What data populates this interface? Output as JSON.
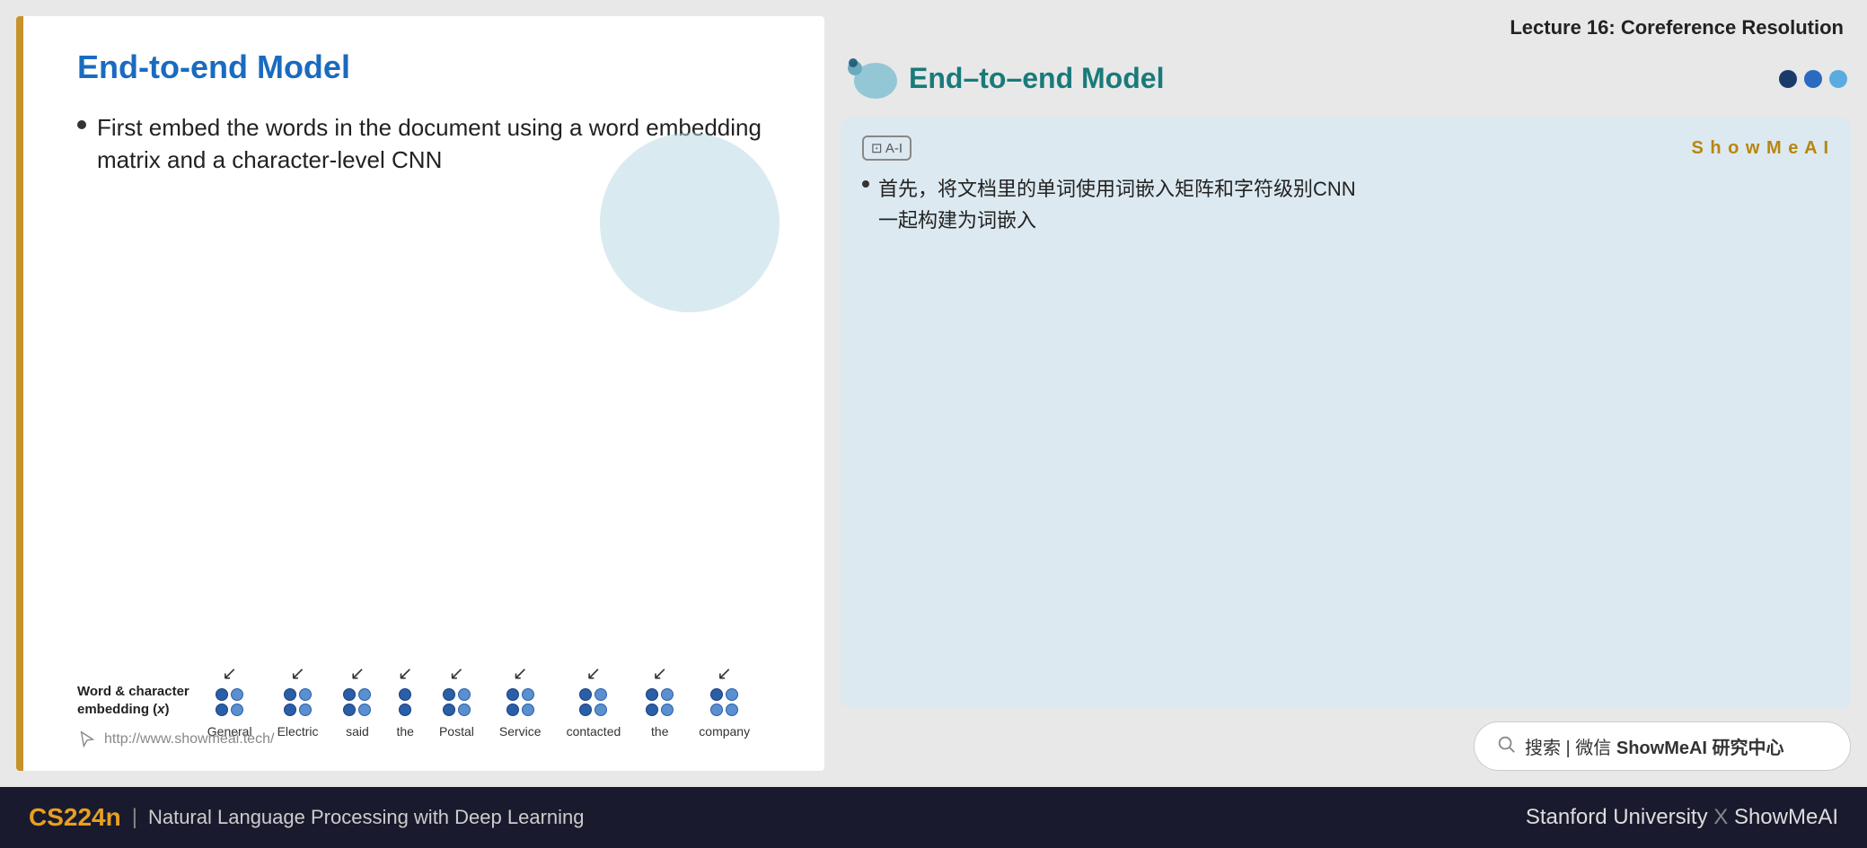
{
  "lecture": {
    "title": "Lecture 16: Coreference Resolution"
  },
  "slide": {
    "title": "End-to-end Model",
    "bullet": "First embed the words in the document using a word embedding matrix and a character-level CNN",
    "url": "http://www.showmeai.tech/",
    "embedding_label": "Word & character embedding (x)",
    "words": [
      {
        "label": "General",
        "dots": [
          [
            1,
            1,
            0
          ],
          [
            1,
            1,
            0
          ]
        ]
      },
      {
        "label": "Electric",
        "dots": [
          [
            1,
            1,
            0
          ],
          [
            1,
            1,
            0
          ]
        ]
      },
      {
        "label": "said",
        "dots": [
          [
            1,
            1,
            0
          ],
          [
            1,
            1,
            0
          ]
        ]
      },
      {
        "label": "the",
        "dots": [
          [
            1,
            0,
            0
          ],
          [
            1,
            0,
            0
          ]
        ]
      },
      {
        "label": "Postal",
        "dots": [
          [
            1,
            1,
            0
          ],
          [
            1,
            1,
            0
          ]
        ]
      },
      {
        "label": "Service",
        "dots": [
          [
            1,
            1,
            0
          ],
          [
            1,
            1,
            0
          ]
        ]
      },
      {
        "label": "contacted",
        "dots": [
          [
            1,
            1,
            0
          ],
          [
            1,
            1,
            0
          ]
        ]
      },
      {
        "label": "the",
        "dots": [
          [
            1,
            1,
            0
          ],
          [
            1,
            1,
            0
          ]
        ]
      },
      {
        "label": "company",
        "dots": [
          [
            1,
            1,
            0
          ],
          [
            1,
            1,
            0
          ]
        ]
      }
    ]
  },
  "right_panel": {
    "model_title": "End–to–end Model",
    "translation_card": {
      "ai_badge": "A-I",
      "brand": "S h o w M e A I",
      "text_line1": "• 首先，将文档里的单词使用词嵌入矩阵和字符级别CNN",
      "text_line2": "一起构建为词嵌入"
    },
    "search": {
      "icon": "🔍",
      "text": "搜索 | 微信 ShowMeAI 研究中心"
    }
  },
  "bottom_bar": {
    "course_code": "CS224n",
    "divider": "|",
    "course_name": "Natural Language Processing with Deep Learning",
    "university": "Stanford University",
    "x": "X",
    "brand": "ShowMeAI"
  }
}
